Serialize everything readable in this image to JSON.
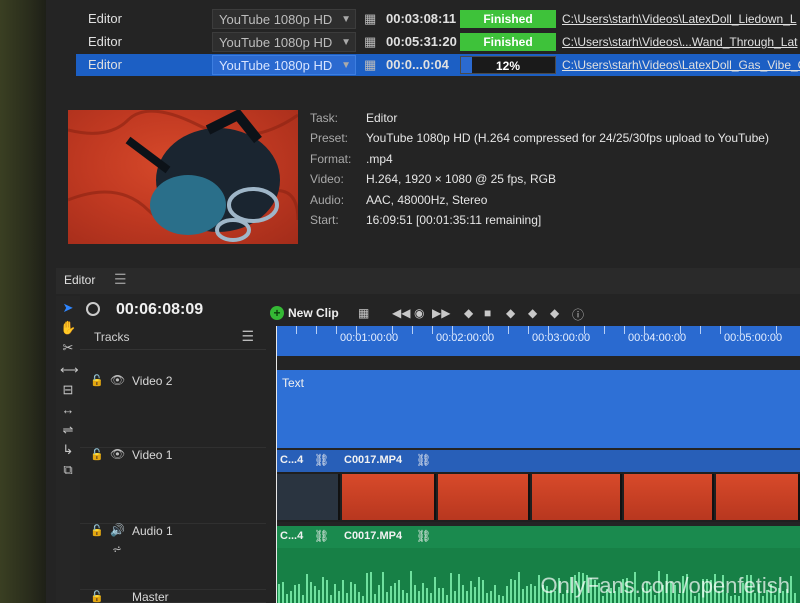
{
  "queue": {
    "rows": [
      {
        "task": "Editor",
        "preset": "YouTube 1080p HD",
        "duration": "00:03:08:11",
        "status": "Finished",
        "status_type": "done",
        "progress": 1.0,
        "path": "C:\\Users\\starh\\Videos\\LatexDoll_Liedown_L"
      },
      {
        "task": "Editor",
        "preset": "YouTube 1080p HD",
        "duration": "00:05:31:20",
        "status": "Finished",
        "status_type": "done",
        "progress": 1.0,
        "path": "C:\\Users\\starh\\Videos\\...Wand_Through_Lat"
      },
      {
        "task": "Editor",
        "preset": "YouTube 1080p HD",
        "duration": "00:0...0:04",
        "status": "12%",
        "status_type": "progress",
        "progress": 0.12,
        "path": "C:\\Users\\starh\\Videos\\LatexDoll_Gas_Vibe_C"
      }
    ]
  },
  "details": {
    "task_label": "Task:",
    "task": "Editor",
    "preset_label": "Preset:",
    "preset": "YouTube 1080p HD (H.264 compressed for 24/25/30fps upload to YouTube)",
    "format_label": "Format:",
    "format": ".mp4",
    "video_label": "Video:",
    "video": "H.264, 1920 × 1080 @ 25 fps, RGB",
    "audio_label": "Audio:",
    "audio": "AAC, 48000Hz, Stereo",
    "start_label": "Start:",
    "start": "16:09:51 [00:01:35:11 remaining]"
  },
  "editor": {
    "tab": "Editor",
    "timecode": "00:06:08:09",
    "tracks_label": "Tracks",
    "new_clip": "New Clip",
    "ruler_labels": [
      "00:01:00:00",
      "00:02:00:00",
      "00:03:00:00",
      "00:04:00:00",
      "00:05:00:00"
    ],
    "tracks": {
      "video2": "Video 2",
      "video1": "Video 1",
      "audio1": "Audio 1",
      "master": "Master"
    },
    "video2_clip": "Text",
    "video1_clips": [
      "C...4",
      "C0017.MP4"
    ],
    "audio1_clips": [
      "C...4",
      "C0017.MP4"
    ]
  },
  "watermark": "OnlyFans.com/openfetish",
  "colors": {
    "accent": "#2a6ad0",
    "finished": "#3ec23a",
    "audio": "#178046"
  }
}
